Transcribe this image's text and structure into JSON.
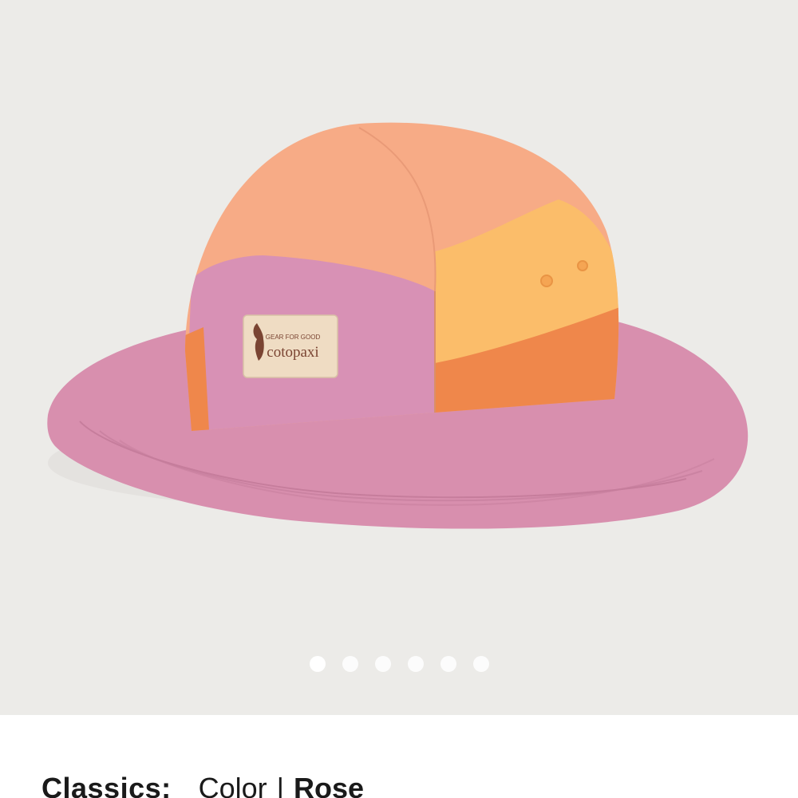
{
  "product": {
    "gallery": {
      "slide_count": 6,
      "active_index": 0,
      "colors": {
        "background": "#ecebe8",
        "brim": "#d88fae",
        "crown_peach": "#f7ab86",
        "side_yellow": "#fbbd6a",
        "side_orange": "#ef874b",
        "front_pink": "#d891b5",
        "label_bg": "#efdcc3",
        "label_text": "#7a4432"
      },
      "logo_tagline": "GEAR FOR GOOD",
      "logo_text": "cotopaxi"
    },
    "collection_label": "Classics:",
    "color_label": "Color",
    "separator": "|",
    "color_value": "Rose"
  }
}
